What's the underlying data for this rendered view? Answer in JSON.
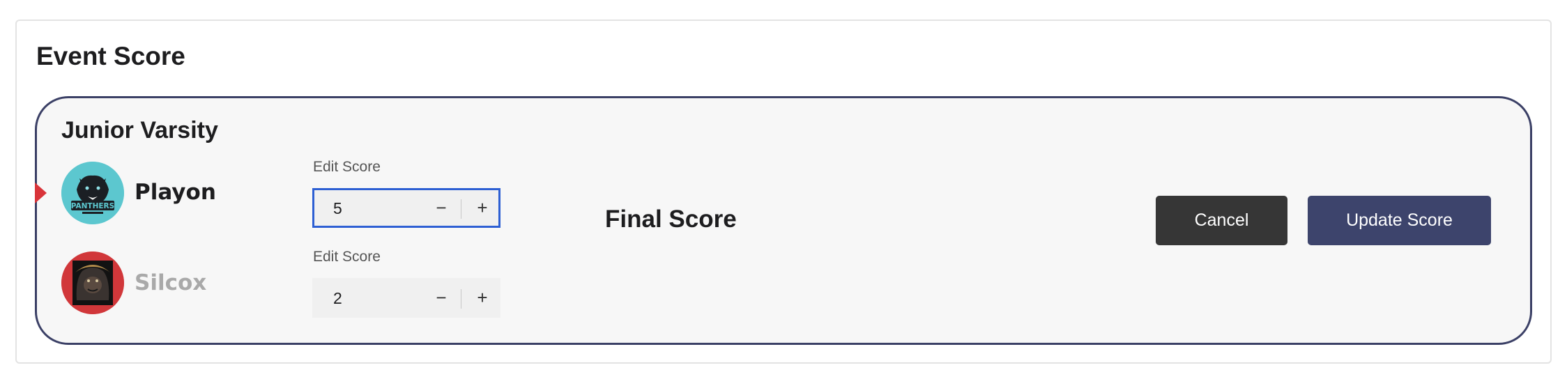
{
  "page": {
    "title": "Event Score"
  },
  "event": {
    "division": "Junior Varsity",
    "final_score_label": "Final Score",
    "teams": [
      {
        "name": "Playon",
        "logo_text": "PANTHERS",
        "logo_bg": "#5cc7cf",
        "name_color": "#1d1d1f",
        "edit_label": "Edit Score",
        "score": "5",
        "decrement": "−",
        "increment": "+"
      },
      {
        "name": "Silcox",
        "logo_bg": "#d1373a",
        "name_color": "#a9a9a9",
        "edit_label": "Edit Score",
        "score": "2",
        "decrement": "−",
        "increment": "+"
      }
    ]
  },
  "actions": {
    "cancel_label": "Cancel",
    "update_label": "Update Score"
  },
  "colors": {
    "accent": "#3d446c",
    "focus": "#2d5fd3",
    "winner_marker": "#d9343a"
  }
}
